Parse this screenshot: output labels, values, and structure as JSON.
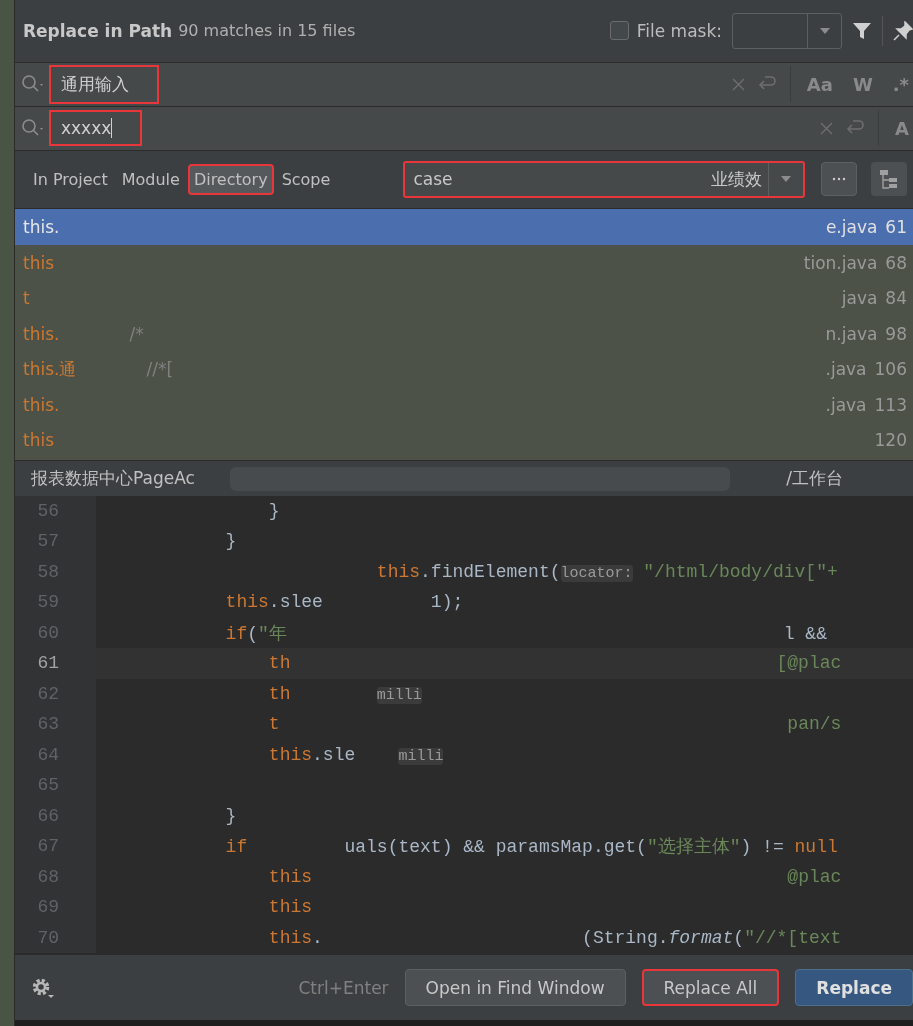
{
  "dialog": {
    "title": "Replace in Path",
    "summary": "90 matches in 15 files",
    "file_mask": {
      "label": "File mask:",
      "checked": false
    }
  },
  "search": {
    "value": "通用输入",
    "highlighted": true,
    "options": [
      "Aa",
      "W",
      ".*"
    ]
  },
  "replace": {
    "value": "xxxxx",
    "highlighted": true,
    "options": [
      "A"
    ]
  },
  "scope_tabs": [
    {
      "label": "In Project",
      "selected": false,
      "highlighted": false
    },
    {
      "label": "Module",
      "selected": false,
      "highlighted": false
    },
    {
      "label": "Directory",
      "selected": true,
      "highlighted": true
    },
    {
      "label": "Scope",
      "selected": false,
      "highlighted": false
    }
  ],
  "directory": {
    "start": "case",
    "end": "业绩效",
    "highlighted": true
  },
  "results": [
    {
      "code": "this.",
      "file": "e.java",
      "line": "61",
      "selected": true
    },
    {
      "code": "this",
      "file": "tion.java",
      "line": "68",
      "selected": false
    },
    {
      "code": "t",
      "file": "java",
      "line": "84",
      "selected": false
    },
    {
      "code": "this.",
      "comment": "/*",
      "file": "n.java",
      "line": "98",
      "selected": false
    },
    {
      "code": "this.通",
      "comment": "//*[",
      "file": ".java",
      "line": "106",
      "selected": false
    },
    {
      "code": "this.",
      "file": ".java",
      "line": "113",
      "selected": false
    },
    {
      "code": "this",
      "line": "120",
      "selected": false
    }
  ],
  "path_bar": {
    "start": "报表数据中心PageAc",
    "end": "/工作台"
  },
  "editor": {
    "lines": [
      {
        "number": "56",
        "current": false,
        "segments": [
          {
            "kind": "plain",
            "text": "                }"
          }
        ]
      },
      {
        "number": "57",
        "current": false,
        "segments": [
          {
            "kind": "plain",
            "text": "            }"
          }
        ]
      },
      {
        "number": "58",
        "current": false,
        "segments": [
          {
            "kind": "keyword",
            "text": "                          this"
          },
          {
            "kind": "plain",
            "text": ".findElement("
          },
          {
            "kind": "hint",
            "text": "locator:"
          },
          {
            "kind": "string",
            "text": " \"/html/body/div[\"+"
          }
        ]
      },
      {
        "number": "59",
        "current": false,
        "segments": [
          {
            "kind": "keyword",
            "text": "            this"
          },
          {
            "kind": "plain",
            "text": ".slee          1);"
          }
        ]
      },
      {
        "number": "60",
        "current": false,
        "segments": [
          {
            "kind": "keyword",
            "text": "            if"
          },
          {
            "kind": "plain",
            "text": "("
          },
          {
            "kind": "string",
            "text": "\"年"
          },
          {
            "kind": "plain",
            "text": "                                              l &&"
          }
        ]
      },
      {
        "number": "61",
        "current": true,
        "segments": [
          {
            "kind": "keyword",
            "text": "                th"
          },
          {
            "kind": "string",
            "text": "                                             [@plac"
          }
        ]
      },
      {
        "number": "62",
        "current": false,
        "segments": [
          {
            "kind": "keyword",
            "text": "                th        "
          },
          {
            "kind": "hint",
            "text": "milli"
          }
        ]
      },
      {
        "number": "63",
        "current": false,
        "segments": [
          {
            "kind": "keyword",
            "text": "                t"
          },
          {
            "kind": "string",
            "text": "                                               pan/s"
          }
        ]
      },
      {
        "number": "64",
        "current": false,
        "segments": [
          {
            "kind": "keyword",
            "text": "                this"
          },
          {
            "kind": "plain",
            "text": ".sle    "
          },
          {
            "kind": "hint",
            "text": "milli"
          }
        ]
      },
      {
        "number": "65",
        "current": false
      },
      {
        "number": "66",
        "current": false,
        "segments": [
          {
            "kind": "plain",
            "text": "            }"
          }
        ]
      },
      {
        "number": "67",
        "current": false,
        "segments": [
          {
            "kind": "keyword",
            "text": "            if"
          },
          {
            "kind": "plain",
            "text": "         uals(text) && paramsMap.get("
          },
          {
            "kind": "string",
            "text": "\"选择主体\""
          },
          {
            "kind": "plain",
            "text": ") != "
          },
          {
            "kind": "keyword",
            "text": "null"
          }
        ]
      },
      {
        "number": "68",
        "current": false,
        "segments": [
          {
            "kind": "keyword",
            "text": "                this"
          },
          {
            "kind": "string",
            "text": "                                            @plac"
          }
        ]
      },
      {
        "number": "69",
        "current": false,
        "segments": [
          {
            "kind": "keyword",
            "text": "                this"
          }
        ]
      },
      {
        "number": "70",
        "current": false,
        "segments": [
          {
            "kind": "keyword",
            "text": "                this"
          },
          {
            "kind": "plain",
            "text": ".                        (String."
          },
          {
            "kind": "italic",
            "text": "format"
          },
          {
            "kind": "plain",
            "text": "("
          },
          {
            "kind": "string",
            "text": "\"//*[text"
          }
        ]
      }
    ]
  },
  "footer": {
    "shortcut": "Ctrl+Enter",
    "buttons": [
      {
        "label": "Open in Find Window",
        "kind": "normal",
        "highlighted": false
      },
      {
        "label": "Replace All",
        "kind": "normal",
        "highlighted": true
      },
      {
        "label": "Replace",
        "kind": "primary",
        "highlighted": false
      }
    ]
  }
}
